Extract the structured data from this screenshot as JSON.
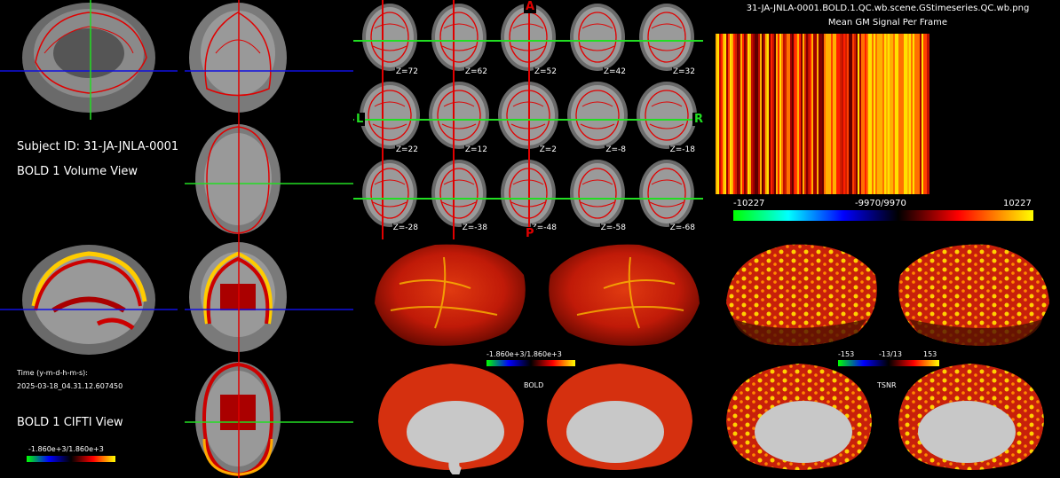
{
  "window": {
    "title": "31-JA-JNLA-0001.BOLD.1.QC.wb.scene.GStimeseries.QC.wb.png"
  },
  "left": {
    "subject_label": "Subject ID: 31-JA-JNLA-0001",
    "volume_view_label": "BOLD 1 Volume View",
    "time_label": "Time (y-m-d-h-m-s):",
    "time_value": "2025-03-18_04.31.12.607450",
    "cifti_view_label": "BOLD 1 CIFTI View",
    "colorbar_text": "-1.860e+3/1.860e+3"
  },
  "axial": {
    "z_labels": [
      "Z=72",
      "Z=62",
      "Z=52",
      "Z=42",
      "Z=32",
      "Z=22",
      "Z=12",
      "Z=2",
      "Z=-8",
      "Z=-18",
      "Z=-28",
      "Z=-38",
      "Z=-48",
      "Z=-58",
      "Z=-68"
    ],
    "orient": {
      "anterior": "A",
      "posterior": "P",
      "left": "L",
      "right": "R"
    }
  },
  "carpet": {
    "title": "31-JA-JNLA-0001.BOLD.1.QC.wb.scene.GStimeseries.QC.wb.png",
    "subtitle": "Mean GM Signal Per Frame",
    "min_label": "-10227",
    "mid_label": "-9970/9970",
    "max_label": "10227"
  },
  "surfaces": {
    "bold_colorbar_text": "-1.860e+3/1.860e+3",
    "bold_label": "BOLD",
    "tsnr_min": "-153",
    "tsnr_mid": "-13/13",
    "tsnr_max": "153",
    "tsnr_label": "TSNR"
  },
  "colors": {
    "red_outline": "#e00000",
    "crosshair_green": "#22dd22",
    "crosshair_blue": "#1010e0",
    "crosshair_red": "#e00000"
  }
}
